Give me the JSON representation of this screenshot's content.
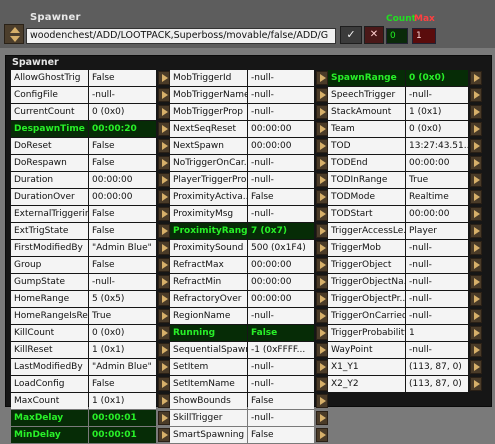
{
  "top": {
    "title": "Spawner",
    "entry_value": "woodenchest/ADD/LOOTPACK,Superboss/movable/false/ADD/G",
    "ok_label": "✓",
    "cancel_label": "✕",
    "count_label": "Count",
    "max_label": "Max",
    "count_value": "0",
    "max_value": "1"
  },
  "main": {
    "title": "Spawner"
  },
  "columns": [
    [
      {
        "name": "AllowGhostTrig",
        "value": "False"
      },
      {
        "name": "ConfigFile",
        "value": "-null-"
      },
      {
        "name": "CurrentCount",
        "value": "0 (0x0)"
      },
      {
        "name": "DespawnTime",
        "value": "00:00:20",
        "highlight": true
      },
      {
        "name": "DoReset",
        "value": "False"
      },
      {
        "name": "DoRespawn",
        "value": "False"
      },
      {
        "name": "Duration",
        "value": "00:00:00"
      },
      {
        "name": "DurationOver",
        "value": "00:00:00"
      },
      {
        "name": "ExternalTriggering",
        "value": "False"
      },
      {
        "name": "ExtTrigState",
        "value": "False"
      },
      {
        "name": "FirstModifiedBy",
        "value": "\"Admin Blue\""
      },
      {
        "name": "Group",
        "value": "False"
      },
      {
        "name": "GumpState",
        "value": "-null-"
      },
      {
        "name": "HomeRange",
        "value": "5 (0x5)"
      },
      {
        "name": "HomeRangeIsRela...",
        "value": "True"
      },
      {
        "name": "KillCount",
        "value": "0 (0x0)"
      },
      {
        "name": "KillReset",
        "value": "1 (0x1)"
      },
      {
        "name": "LastModifiedBy",
        "value": "\"Admin Blue\""
      },
      {
        "name": "LoadConfig",
        "value": "False"
      },
      {
        "name": "MaxCount",
        "value": "1 (0x1)"
      },
      {
        "name": "MaxDelay",
        "value": "00:00:01",
        "highlight": true
      },
      {
        "name": "MinDelay",
        "value": "00:00:01",
        "highlight": true
      }
    ],
    [
      {
        "name": "MobTriggerId",
        "value": "-null-"
      },
      {
        "name": "MobTriggerName",
        "value": "-null-"
      },
      {
        "name": "MobTriggerProp",
        "value": "-null-"
      },
      {
        "name": "NextSeqReset",
        "value": "00:00:00"
      },
      {
        "name": "NextSpawn",
        "value": "00:00:00"
      },
      {
        "name": "NoTriggerOnCar...",
        "value": "-null-"
      },
      {
        "name": "PlayerTriggerProp",
        "value": "-null-"
      },
      {
        "name": "ProximityActiva...",
        "value": "False"
      },
      {
        "name": "ProximityMsg",
        "value": "-null-"
      },
      {
        "name": "ProximityRange",
        "value": "7 (0x7)",
        "highlight": true
      },
      {
        "name": "ProximitySound",
        "value": "500 (0x1F4)"
      },
      {
        "name": "RefractMax",
        "value": "00:00:00"
      },
      {
        "name": "RefractMin",
        "value": "00:00:00"
      },
      {
        "name": "RefractoryOver",
        "value": "00:00:00"
      },
      {
        "name": "RegionName",
        "value": "-null-"
      },
      {
        "name": "Running",
        "value": "False",
        "highlight": true
      },
      {
        "name": "SequentialSpawn",
        "value": "-1 (0xFFFF..."
      },
      {
        "name": "SetItem",
        "value": "-null-"
      },
      {
        "name": "SetItemName",
        "value": "-null-"
      },
      {
        "name": "ShowBounds",
        "value": "False"
      },
      {
        "name": "SkillTrigger",
        "value": "-null-"
      },
      {
        "name": "SmartSpawning",
        "value": "False"
      }
    ],
    [
      {
        "name": "SpawnRange",
        "value": "0 (0x0)",
        "highlight": true
      },
      {
        "name": "SpeechTrigger",
        "value": "-null-"
      },
      {
        "name": "StackAmount",
        "value": "1 (0x1)"
      },
      {
        "name": "Team",
        "value": "0 (0x0)"
      },
      {
        "name": "TOD",
        "value": "13:27:43.51..."
      },
      {
        "name": "TODEnd",
        "value": "00:00:00"
      },
      {
        "name": "TODInRange",
        "value": "True"
      },
      {
        "name": "TODMode",
        "value": "Realtime"
      },
      {
        "name": "TODStart",
        "value": "00:00:00"
      },
      {
        "name": "TriggerAccessLe...",
        "value": "Player"
      },
      {
        "name": "TriggerMob",
        "value": "-null-"
      },
      {
        "name": "TriggerObject",
        "value": "-null-"
      },
      {
        "name": "TriggerObjectNa...",
        "value": "-null-"
      },
      {
        "name": "TriggerObjectPr...",
        "value": "-null-"
      },
      {
        "name": "TriggerOnCarried",
        "value": "-null-"
      },
      {
        "name": "TriggerProbability",
        "value": "1"
      },
      {
        "name": "WayPoint",
        "value": "-null-"
      },
      {
        "name": "X1_Y1",
        "value": "(113, 87, 0)"
      },
      {
        "name": "X2_Y2",
        "value": "(113, 87, 0)"
      }
    ]
  ]
}
